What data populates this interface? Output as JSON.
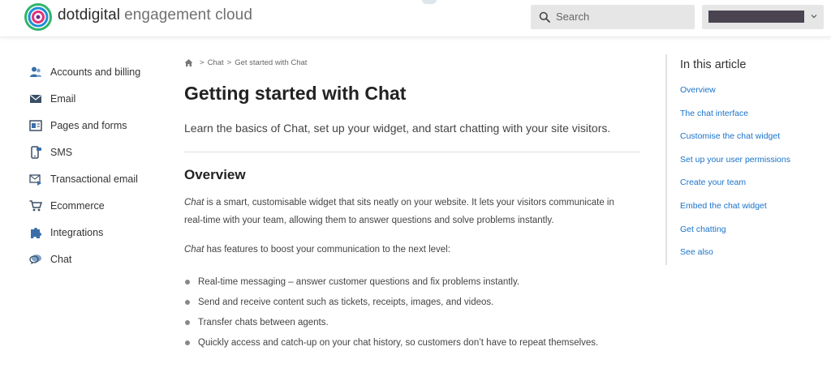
{
  "header": {
    "brand_primary": "dotdigital",
    "brand_secondary": "engagement cloud",
    "search_placeholder": "Search",
    "user_name_redacted": true
  },
  "sidebar": {
    "items": [
      {
        "label": "Accounts and billing",
        "icon": "user-group-icon"
      },
      {
        "label": "Email",
        "icon": "envelope-icon"
      },
      {
        "label": "Pages and forms",
        "icon": "page-icon"
      },
      {
        "label": "SMS",
        "icon": "mobile-phone-icon"
      },
      {
        "label": "Transactional email",
        "icon": "transactional-email-icon"
      },
      {
        "label": "Ecommerce",
        "icon": "shopping-cart-icon"
      },
      {
        "label": "Integrations",
        "icon": "puzzle-piece-icon"
      },
      {
        "label": "Chat",
        "icon": "chat-bubble-icon"
      }
    ]
  },
  "breadcrumb": {
    "sep": ">",
    "items": [
      "Chat",
      "Get started with Chat"
    ]
  },
  "article": {
    "title": "Getting started with Chat",
    "lede": "Learn the basics of Chat, set up your widget, and start chatting with your site visitors.",
    "overview_heading": "Overview",
    "para1_em": "Chat",
    "para1_rest": " is a smart, customisable widget that sits neatly on your website. It lets your visitors communicate in real-time with your team, allowing them to answer questions and solve problems instantly.",
    "para2_em": "Chat",
    "para2_rest": " has features to boost your communication to the next level:",
    "bullets": [
      "Real-time messaging – answer customer questions and fix problems instantly.",
      "Send and receive content such as tickets, receipts, images, and videos.",
      "Transfer chats between agents.",
      "Quickly access and catch-up on your chat history, so customers don’t have to repeat themselves."
    ]
  },
  "toc": {
    "title": "In this article",
    "links": [
      "Overview",
      "The chat interface",
      "Customise the chat widget",
      "Set up your user permissions",
      "Create your team",
      "Embed the chat widget",
      "Get chatting",
      "See also"
    ]
  },
  "colors": {
    "link": "#1a73c9",
    "logo_ring_green": "#2fb56a",
    "logo_ring_blue": "#1f8dd6",
    "logo_ring_pink": "#e0327a",
    "icon_blue": "#3a6ea8"
  }
}
